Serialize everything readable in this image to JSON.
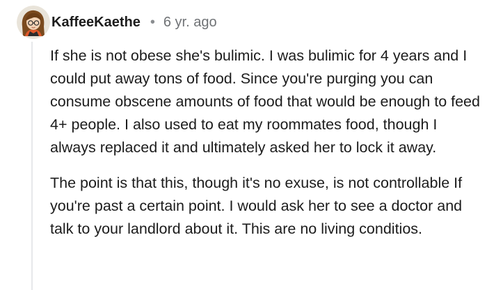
{
  "comment": {
    "author": "KaffeeKaethe",
    "separator": "•",
    "timestamp": "6 yr. ago",
    "avatar_icon": "cartoon-girl-avatar-icon",
    "paragraphs": [
      "If she is not obese she's bulimic. I was bulimic for 4 years and I could put away tons of food. Since you're purging you can consume obscene amounts of food that would be enough to feed 4+ people. I also used to eat my roommates food, though I always replaced it and ultimately asked her to lock it away.",
      "The point is that this, though it's no exuse, is not controllable If you're past a certain point. I would ask her to see a doctor and talk to your landlord about it. This are no living conditios."
    ]
  },
  "colors": {
    "text": "#1c1c1c",
    "muted": "#6f7275",
    "thread_line": "#e6e8ea"
  }
}
